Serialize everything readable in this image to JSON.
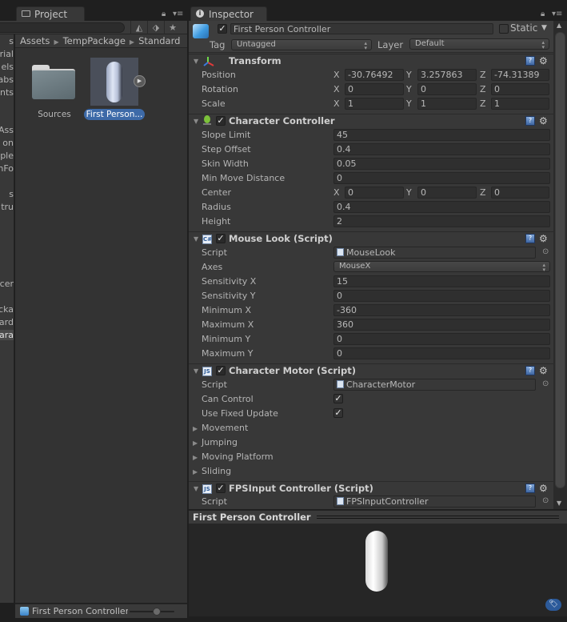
{
  "project": {
    "tab_label": "Project",
    "breadcrumb": [
      "Assets",
      "TempPackage",
      "Standard"
    ],
    "left_tree": [
      "s",
      "rial",
      "els",
      "abs",
      "nts",
      "Ass",
      "on",
      "ple",
      "nFo",
      "s",
      "tru",
      "icer",
      "cka",
      "dard",
      "ara"
    ],
    "assets": [
      {
        "name": "Sources",
        "type": "folder"
      },
      {
        "name": "First Person...",
        "type": "prefab",
        "selected": true
      }
    ],
    "status_label": "First Person Controller",
    "zoom_slider_value": 0.6
  },
  "inspector": {
    "tab_label": "Inspector",
    "object_name": "First Person Controller",
    "active": true,
    "static_label": "Static",
    "static": false,
    "tag_label": "Tag",
    "tag_value": "Untagged",
    "layer_label": "Layer",
    "layer_value": "Default",
    "transform": {
      "title": "Transform",
      "rows": [
        {
          "label": "Position",
          "x": "-30.76492",
          "y": "3.257863",
          "z": "-74.31389"
        },
        {
          "label": "Rotation",
          "x": "0",
          "y": "0",
          "z": "0"
        },
        {
          "label": "Scale",
          "x": "1",
          "y": "1",
          "z": "1"
        }
      ]
    },
    "character_controller": {
      "title": "Character Controller",
      "slope_limit": {
        "label": "Slope Limit",
        "value": "45"
      },
      "step_offset": {
        "label": "Step Offset",
        "value": "0.4"
      },
      "skin_width": {
        "label": "Skin Width",
        "value": "0.05"
      },
      "min_move": {
        "label": "Min Move Distance",
        "value": "0"
      },
      "center": {
        "label": "Center",
        "x": "0",
        "y": "0",
        "z": "0"
      },
      "radius": {
        "label": "Radius",
        "value": "0.4"
      },
      "height": {
        "label": "Height",
        "value": "2"
      }
    },
    "mouse_look": {
      "title": "Mouse Look (Script)",
      "script": {
        "label": "Script",
        "value": "MouseLook"
      },
      "axes": {
        "label": "Axes",
        "value": "MouseX"
      },
      "fields": [
        {
          "label": "Sensitivity X",
          "value": "15"
        },
        {
          "label": "Sensitivity Y",
          "value": "0"
        },
        {
          "label": "Minimum X",
          "value": "-360"
        },
        {
          "label": "Maximum X",
          "value": "360"
        },
        {
          "label": "Minimum Y",
          "value": "0"
        },
        {
          "label": "Maximum Y",
          "value": "0"
        }
      ]
    },
    "character_motor": {
      "title": "Character Motor (Script)",
      "script": {
        "label": "Script",
        "value": "CharacterMotor"
      },
      "can_control": {
        "label": "Can Control",
        "checked": true
      },
      "use_fixed_update": {
        "label": "Use Fixed Update",
        "checked": true
      },
      "foldouts": [
        "Movement",
        "Jumping",
        "Moving Platform",
        "Sliding"
      ]
    },
    "fps_input": {
      "title": "FPSInput Controller (Script)",
      "script": {
        "label": "Script",
        "value": "FPSInputController"
      }
    },
    "axis_labels": {
      "x": "X",
      "y": "Y",
      "z": "Z"
    },
    "preview_title": "First Person Controller"
  },
  "colors": {
    "selection": "#3d6aa8",
    "panel": "#383838",
    "field": "#2f2f2f"
  }
}
